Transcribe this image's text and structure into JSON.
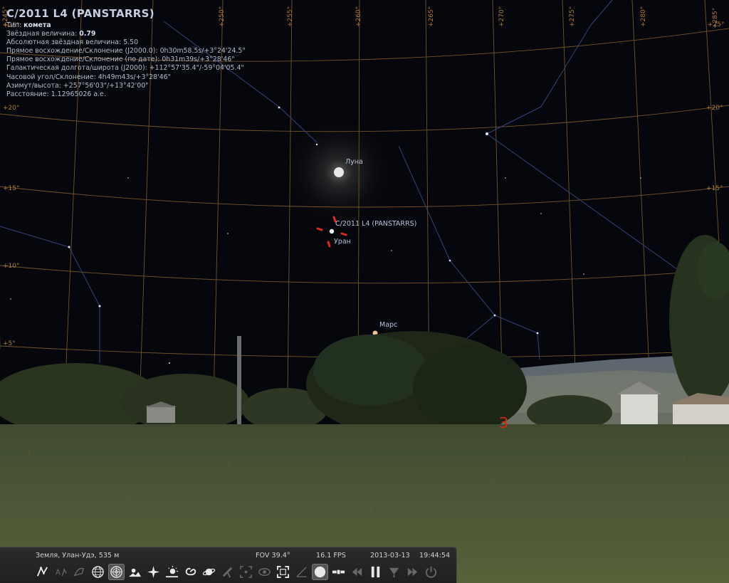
{
  "object_info": {
    "title": "C/2011 L4 (PANSTARRS)",
    "rows": [
      {
        "label": "Тип:",
        "value": "комета",
        "bold": true
      },
      {
        "label": "Звёздная величина:",
        "value": "0.79",
        "bold": true
      },
      {
        "label": "Абсолютная звёздная величина:",
        "value": "5.50",
        "bold": false
      },
      {
        "label": "Прямое восхождение/Склонение (J2000.0):",
        "value": "0h30m58.5s/+3°24'24.5\"",
        "bold": false
      },
      {
        "label": "Прямое восхождение/Склонение (по дате):",
        "value": "0h31m39s/+3°28'46\"",
        "bold": false
      },
      {
        "label": "Галактическая долгота/широта (J2000):",
        "value": "+112°57'35.4\"/-59°04'05.4\"",
        "bold": false
      },
      {
        "label": "Часовой угол/Склонение:",
        "value": "4h49m43s/+3°28'46\"",
        "bold": false
      },
      {
        "label": "Азимут/высота:",
        "value": "+257°56'03\"/+13°42'00\"",
        "bold": false
      },
      {
        "label": "Расстояние:",
        "value": "1.12965026 а.е.",
        "bold": false
      }
    ]
  },
  "sky_labels": {
    "moon": "Луна",
    "comet": "C/2011 L4 (PANSTARRS)",
    "uranus": "Уран",
    "mars": "Марс"
  },
  "grid": {
    "azimuth_labels": [
      "+245°",
      "+250°",
      "+255°",
      "+260°",
      "+265°",
      "+270°",
      "+275°",
      "+280°",
      "+285°"
    ],
    "altitude_labels_left": [
      "+25°",
      "+20°",
      "+15°",
      "+10°",
      "+5°"
    ],
    "altitude_labels_right": [
      "+25°",
      "+20°",
      "+15°"
    ]
  },
  "compass": {
    "west_marker": "З"
  },
  "status_bar": {
    "location": "Земля, Улан-Удэ, 535 м",
    "fov": "FOV 39.4°",
    "fps": "16.1 FPS",
    "date": "2013-03-13",
    "time": "19:44:54"
  },
  "toolbar": [
    {
      "icon": "constellation-lines-icon",
      "state": "normal"
    },
    {
      "icon": "constellation-labels-icon",
      "state": "dim"
    },
    {
      "icon": "constellation-art-icon",
      "state": "dim"
    },
    {
      "icon": "equatorial-grid-icon",
      "state": "normal"
    },
    {
      "icon": "azimuthal-grid-icon",
      "state": "active"
    },
    {
      "icon": "ground-icon",
      "state": "normal"
    },
    {
      "icon": "cardinal-points-icon",
      "state": "normal"
    },
    {
      "icon": "atmosphere-icon",
      "state": "normal"
    },
    {
      "icon": "nebulae-icon",
      "state": "normal"
    },
    {
      "icon": "planets-labels-icon",
      "state": "normal"
    },
    {
      "icon": "equatorial-mount-icon",
      "state": "dim"
    },
    {
      "icon": "center-object-icon",
      "state": "dim"
    },
    {
      "icon": "night-mode-icon",
      "state": "dim"
    },
    {
      "icon": "fullscreen-icon",
      "state": "normal"
    },
    {
      "icon": "ocular-icon",
      "state": "dim"
    },
    {
      "icon": "telescope-control-icon",
      "state": "active"
    },
    {
      "icon": "satellites-icon",
      "state": "normal"
    },
    {
      "icon": "decrease-time-speed-icon",
      "state": "dim"
    },
    {
      "icon": "pause-icon",
      "state": "normal"
    },
    {
      "icon": "set-time-now-icon",
      "state": "dim"
    },
    {
      "icon": "increase-time-speed-icon",
      "state": "dim"
    },
    {
      "icon": "quit-icon",
      "state": "dim"
    }
  ],
  "colors": {
    "sky": "#05070c",
    "grid": "#a8743a",
    "constellation": "#34447a",
    "marker": "#e0281a",
    "ground": "#4a5534"
  }
}
